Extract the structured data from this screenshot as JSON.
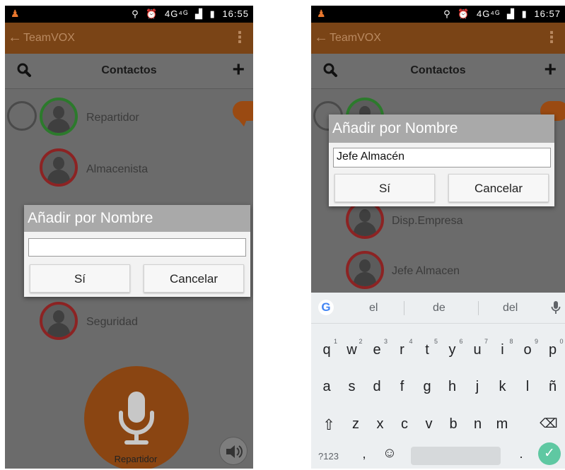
{
  "colors": {
    "accent": "#7a4416",
    "app_background": "#6b6b6b",
    "dialog_header": "#a9a9a9",
    "enter_key": "#5fc8a2"
  },
  "screen1": {
    "status": {
      "notification_icon": "person-alert-icon",
      "icons": [
        "location-icon",
        "alarm-icon"
      ],
      "network": "4G⁴ᴳ",
      "time": "16:55"
    },
    "appbar": {
      "back": "←",
      "title": "TeamVOX",
      "menu": "⋮"
    },
    "subbar": {
      "search_icon": "search-icon",
      "title": "Contactos",
      "add": "+"
    },
    "contacts": [
      {
        "name": "Repartidor",
        "status": "green"
      },
      {
        "name": "Almacenista",
        "status": "red"
      },
      {
        "name": "Seguridad",
        "status": "red"
      }
    ],
    "dialog": {
      "title": "Añadir por Nombre",
      "value": "",
      "yes": "Sí",
      "cancel": "Cancelar"
    },
    "mic_caption": "Repartidor"
  },
  "screen2": {
    "status": {
      "notification_icon": "person-alert-icon",
      "icons": [
        "location-icon",
        "alarm-icon"
      ],
      "network": "4G⁴ᴳ",
      "time": "16:57"
    },
    "appbar": {
      "back": "←",
      "title": "TeamVOX",
      "menu": "⋮"
    },
    "subbar": {
      "search_icon": "search-icon",
      "title": "Contactos",
      "add": "+"
    },
    "contacts": [
      {
        "name": "Disp.Empresa",
        "status": "red"
      },
      {
        "name": "Jefe Almacen",
        "status": "red"
      }
    ],
    "dialog": {
      "title": "Añadir por Nombre",
      "value": "Jefe Almacén",
      "yes": "Sí",
      "cancel": "Cancelar"
    },
    "keyboard": {
      "suggestions": [
        "el",
        "de",
        "del"
      ],
      "row1": [
        "q",
        "w",
        "e",
        "r",
        "t",
        "y",
        "u",
        "i",
        "o",
        "p"
      ],
      "row1_hints": [
        "1",
        "2",
        "3",
        "4",
        "5",
        "6",
        "7",
        "8",
        "9",
        "0"
      ],
      "row2": [
        "a",
        "s",
        "d",
        "f",
        "g",
        "h",
        "j",
        "k",
        "l",
        "ñ"
      ],
      "row3": [
        "z",
        "x",
        "c",
        "v",
        "b",
        "n",
        "m"
      ],
      "shift": "⇧",
      "backspace": "⌫",
      "symbols": "?123",
      "comma": ",",
      "emoji": "☺",
      "period": ".",
      "enter": "✓"
    }
  }
}
